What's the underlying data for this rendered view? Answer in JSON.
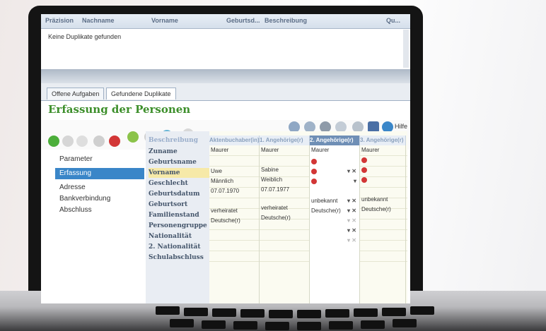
{
  "duplicates": {
    "columns": [
      "Präzision",
      "Nachname",
      "Vorname",
      "Geburtsd...",
      "Beschreibung",
      "Qu..."
    ],
    "message": "Keine Duplikate gefunden"
  },
  "tabs": [
    {
      "label": "Offene Aufgaben"
    },
    {
      "label": "Gefundene Duplikate"
    }
  ],
  "page_title": "Erfassung der Personen",
  "toolbar": {
    "help_label": "Hilfe"
  },
  "nav": [
    {
      "label": "Parameter"
    },
    {
      "label": "Erfassung"
    },
    {
      "label": "Adresse"
    },
    {
      "label": "Bankverbindung"
    },
    {
      "label": "Abschluss"
    }
  ],
  "grid": {
    "header_label": "Beschreibung",
    "columns": [
      "Aktenbuchaber(in)",
      "1. Angehörige(r)",
      "2. Angehörige(r)",
      "3. Angehörige(r)"
    ],
    "row_labels": [
      "Zuname",
      "Geburtsname",
      "Vorname",
      "Geschlecht",
      "Geburtsdatum",
      "Geburtsort",
      "Familienstand",
      "Personengruppe",
      "Nationalität",
      "2. Nationalität",
      "Schulabschluss"
    ],
    "col1": [
      "Maurer",
      "",
      "Uwe",
      "Männlich",
      "07.07.1970",
      "",
      "verheiratet",
      "Deutsche(r)"
    ],
    "col2": [
      "Maurer",
      "",
      "Sabine",
      "Weiblich",
      "07.07.1977",
      "",
      "verheiratet",
      "Deutsche(r)"
    ],
    "col3": [
      "Maurer",
      "",
      "",
      "",
      "",
      "unbekannt",
      "Deutsche(r)"
    ],
    "col4": [
      "Maurer",
      "",
      "",
      "",
      "unbekannt",
      "Deutsche(r)"
    ]
  },
  "colors": {
    "accent": "#3d8f2b",
    "selection": "#3a86c8"
  }
}
